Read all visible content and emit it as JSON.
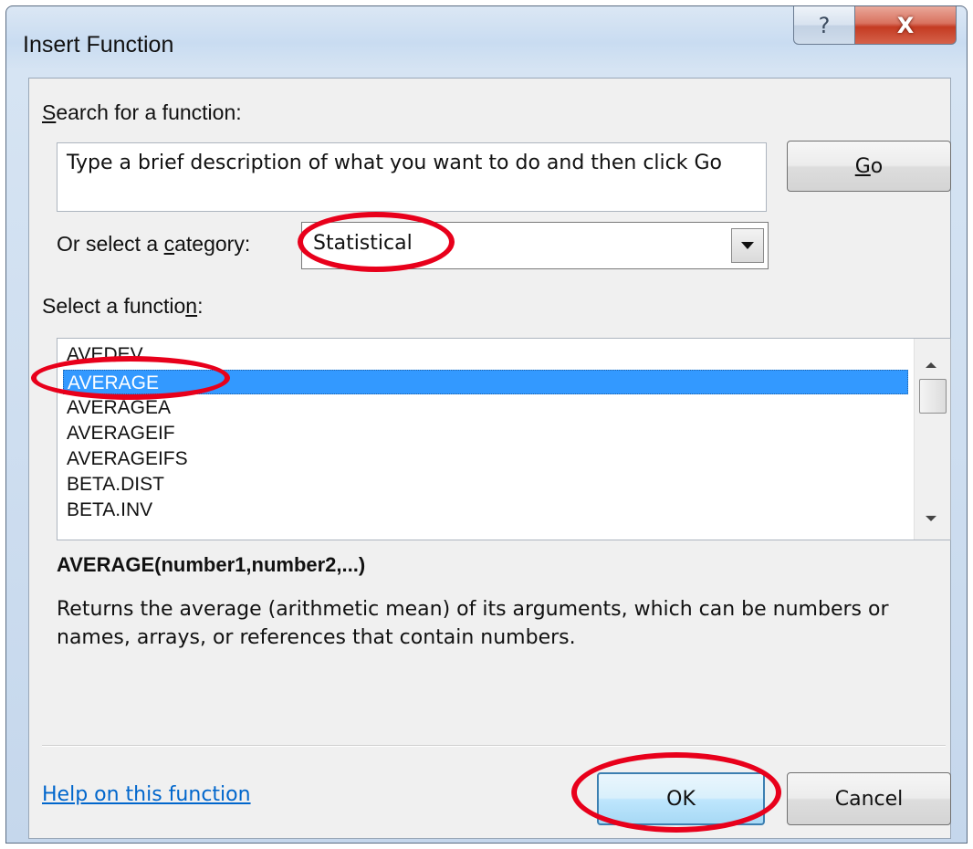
{
  "window": {
    "title": "Insert Function",
    "help_glyph": "?",
    "close_glyph": "X"
  },
  "search": {
    "label": "Search for a function:",
    "label_access_key": "S",
    "label_rest": "earch for a function:",
    "value": "Type a brief description of what you want to do and then click Go",
    "go_label_key": "G",
    "go_label_rest": "o"
  },
  "category": {
    "label_pre": "Or select a ",
    "label_key": "c",
    "label_post": "ategory:",
    "selected": "Statistical"
  },
  "functions": {
    "label_pre": "Select a functio",
    "label_key": "n",
    "label_post": ":",
    "items": [
      "AVEDEV",
      "AVERAGE",
      "AVERAGEA",
      "AVERAGEIF",
      "AVERAGEIFS",
      "BETA.DIST",
      "BETA.INV"
    ],
    "selected": "AVERAGE"
  },
  "details": {
    "signature": "AVERAGE(number1,number2,...)",
    "description": "Returns the average (arithmetic mean) of its arguments, which can be numbers or names, arrays, or references that contain numbers."
  },
  "footer": {
    "help_link": "Help on this function",
    "ok_label": "OK",
    "cancel_label": "Cancel"
  },
  "colors": {
    "selection": "#3399ff",
    "annotation": "#e8001b",
    "link": "#0066cc"
  }
}
